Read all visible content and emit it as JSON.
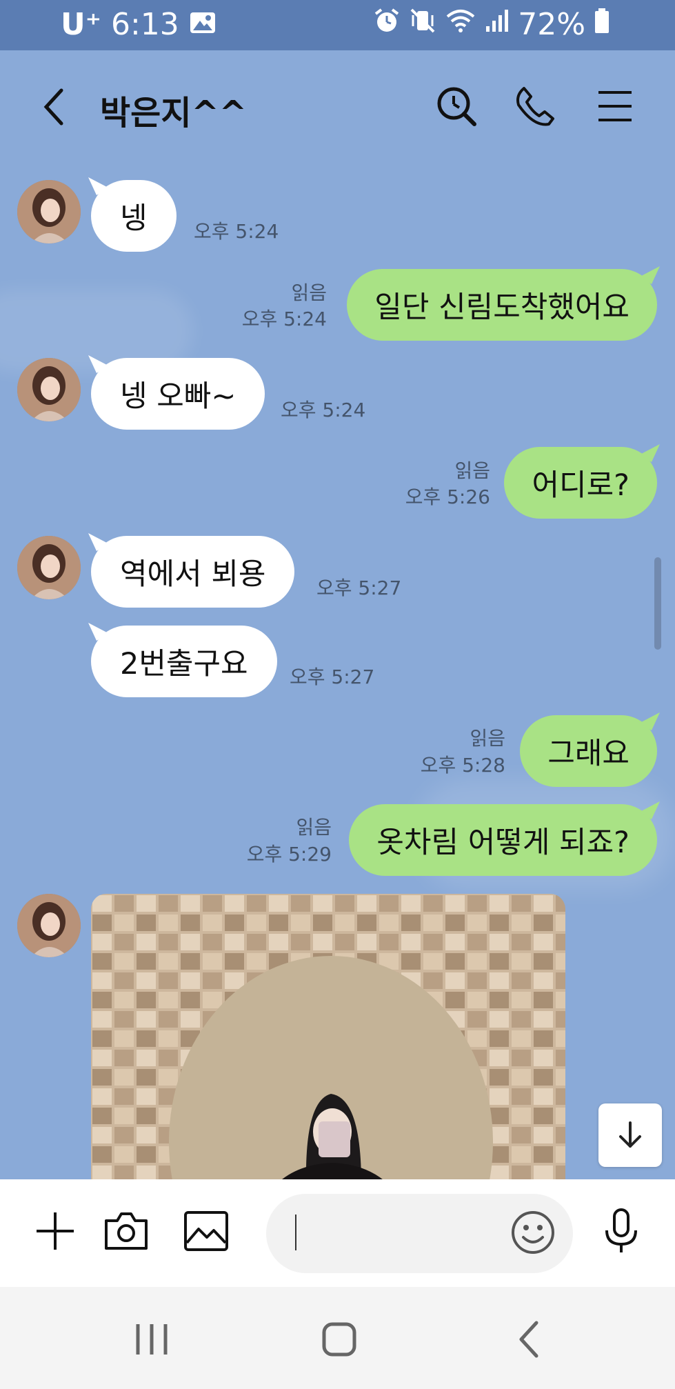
{
  "status_bar": {
    "carrier": "U⁺",
    "time": "6:13",
    "battery": "72%"
  },
  "header": {
    "title": "박은지^^"
  },
  "messages": [
    {
      "dir": "in",
      "text": "넹",
      "time": "오후 5:24"
    },
    {
      "dir": "out",
      "text": "일단 신림도착했어요",
      "read": "읽음",
      "time": "오후 5:24"
    },
    {
      "dir": "in",
      "text": "넹 오빠~",
      "time": "오후 5:24"
    },
    {
      "dir": "out",
      "text": "어디로?",
      "read": "읽음",
      "time": "오후 5:26"
    },
    {
      "dir": "in",
      "text": "역에서 뵈용",
      "time": "오후 5:27"
    },
    {
      "dir": "in",
      "text": "2번출구요",
      "time": "오후 5:27"
    },
    {
      "dir": "out",
      "text": "그래요",
      "read": "읽음",
      "time": "오후 5:28"
    },
    {
      "dir": "out",
      "text": "옷차림 어떻게 되죠?",
      "read": "읽음",
      "time": "오후 5:29"
    }
  ],
  "colors": {
    "background": "#8aaad8",
    "status_bar": "#5b7db3",
    "incoming_bubble": "#ffffff",
    "outgoing_bubble": "#a9e285"
  },
  "icons": [
    "back-icon",
    "search-icon",
    "phone-icon",
    "menu-icon",
    "plus-icon",
    "camera-icon",
    "gallery-icon",
    "emoji-icon",
    "mic-icon",
    "arrow-down-icon",
    "recents-icon",
    "home-icon",
    "nav-back-icon"
  ]
}
